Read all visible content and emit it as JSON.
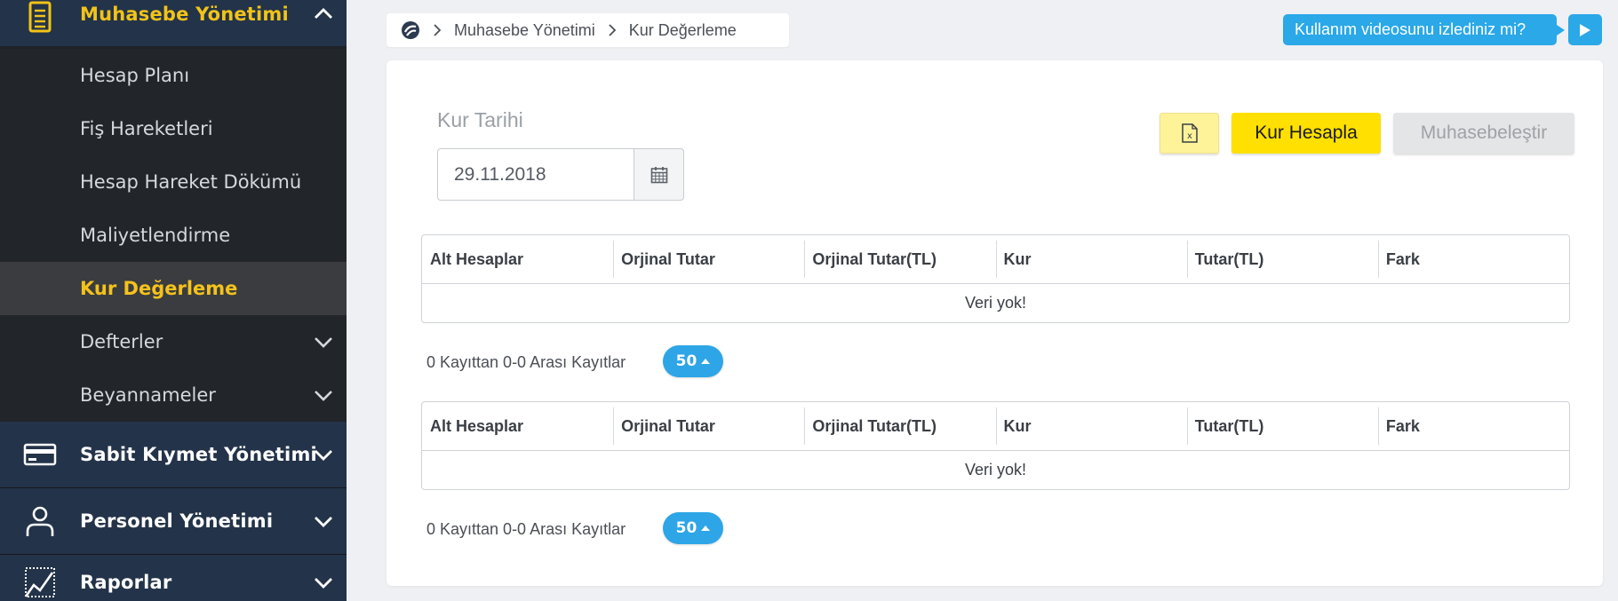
{
  "sidebar": {
    "accounting": {
      "label": "Muhasebe Yönetimi",
      "icon": "clipboard-list-icon"
    },
    "sub_items": [
      {
        "label": "Hesap Planı"
      },
      {
        "label": "Fiş Hareketleri"
      },
      {
        "label": "Hesap Hareket Dökümü"
      },
      {
        "label": "Maliyetlendirme"
      },
      {
        "label": "Kur Değerleme"
      },
      {
        "label": "Defterler"
      },
      {
        "label": "Beyannameler"
      }
    ],
    "fixed_assets": {
      "label": "Sabit Kıymet Yönetimi",
      "icon": "credit-card-icon"
    },
    "personnel": {
      "label": "Personel Yönetimi",
      "icon": "user-icon"
    },
    "reports": {
      "label": "Raporlar",
      "icon": "chart-icon"
    }
  },
  "breadcrumb": {
    "items": [
      "Muhasebe Yönetimi",
      "Kur Değerleme"
    ]
  },
  "video_hint": {
    "text": "Kullanım videosunu izlediniz mi?"
  },
  "form": {
    "date_label": "Kur Tarihi",
    "date_value": "29.11.2018"
  },
  "buttons": {
    "excel": "",
    "calculate": "Kur Hesapla",
    "post": "Muhasebeleştir"
  },
  "tables": [
    {
      "columns": [
        "Alt Hesaplar",
        "Orjinal Tutar",
        "Orjinal Tutar(TL)",
        "Kur",
        "Tutar(TL)",
        "Fark"
      ],
      "empty_text": "Veri yok!",
      "pager_text": "0 Kayıttan 0-0 Arası Kayıtlar",
      "page_size": "50"
    },
    {
      "columns": [
        "Alt Hesaplar",
        "Orjinal Tutar",
        "Orjinal Tutar(TL)",
        "Kur",
        "Tutar(TL)",
        "Fark"
      ],
      "empty_text": "Veri yok!",
      "pager_text": "0 Kayıttan 0-0 Arası Kayıtlar",
      "page_size": "50"
    }
  ],
  "colors": {
    "accent_yellow": "#ffe000",
    "sidebar_active_text": "#f5c21b",
    "info_blue": "#2aa8e8",
    "sidebar_bg": "#22252a",
    "sidebar_section_bg": "#233349"
  }
}
